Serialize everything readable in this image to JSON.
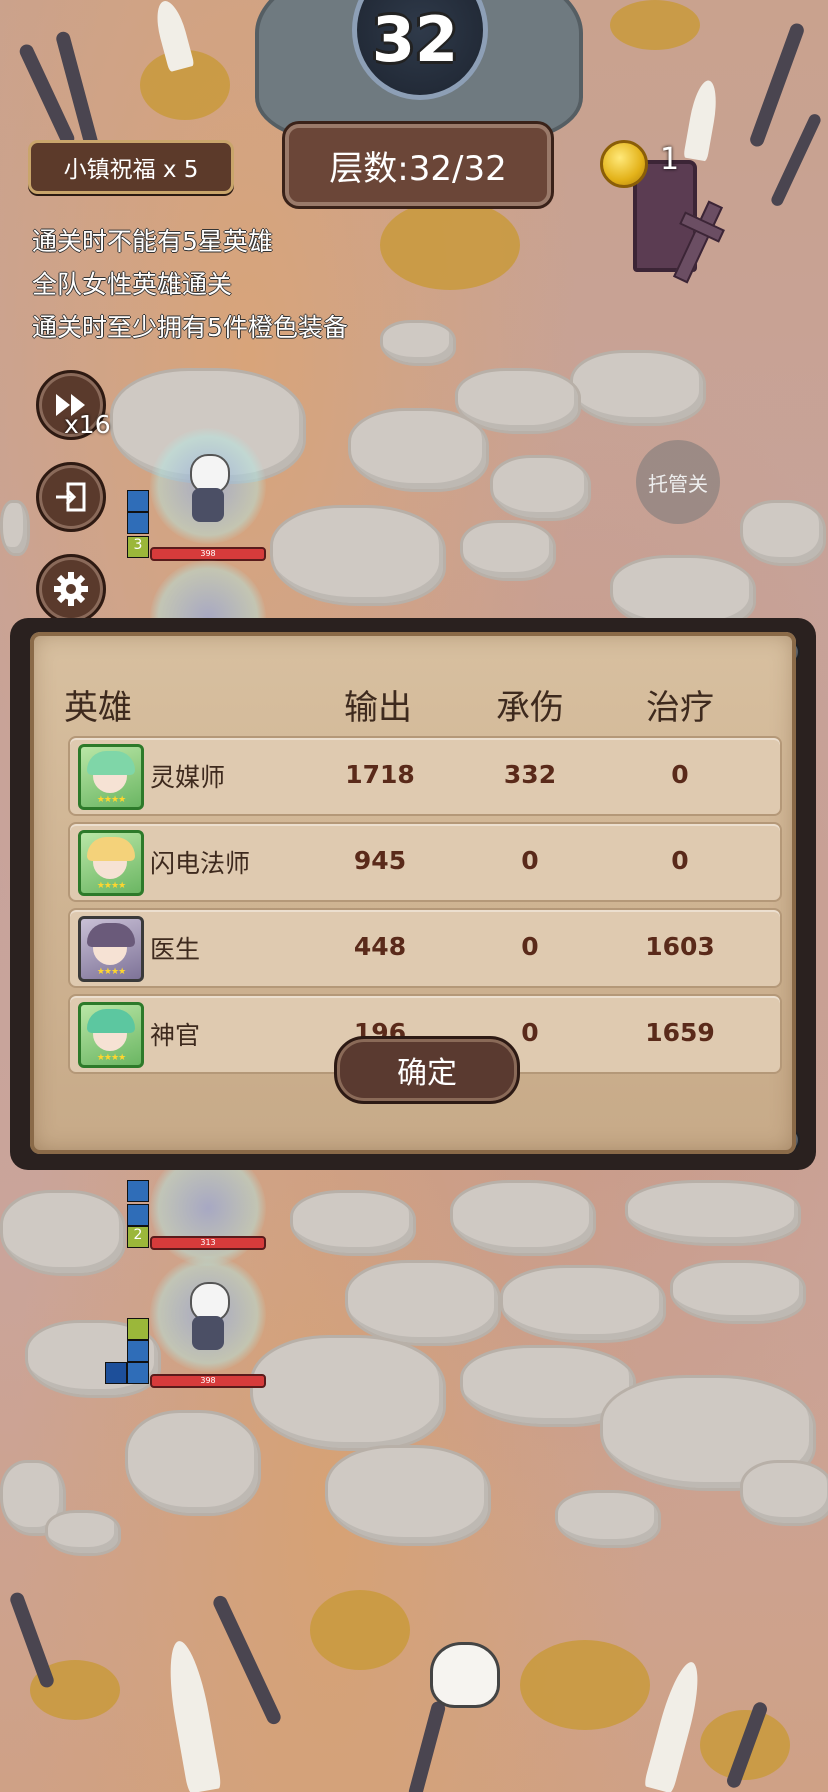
{
  "hud": {
    "timer": "32",
    "blessing": "小镇祝福 x 5",
    "floor": "层数:32/32",
    "coins": "1",
    "conditions": [
      "通关时不能有5星英雄",
      "全队女性英雄通关",
      "通关时至少拥有5件橙色装备"
    ],
    "speed": "x16",
    "auto_label": "托管关"
  },
  "units": {
    "hp": [
      "398",
      "313",
      "398"
    ],
    "levels": [
      "3",
      "2"
    ]
  },
  "results": {
    "headers": {
      "hero": "英雄",
      "output": "输出",
      "damage_taken": "承伤",
      "healing": "治疗"
    },
    "rows": [
      {
        "name": "灵媒师",
        "output": "1718",
        "taken": "332",
        "heal": "0",
        "hair": "#7fd6a8"
      },
      {
        "name": "闪电法师",
        "output": "945",
        "taken": "0",
        "heal": "0",
        "hair": "#f4d27a"
      },
      {
        "name": "医生",
        "output": "448",
        "taken": "0",
        "heal": "1603",
        "hair": "#6a5a7a"
      },
      {
        "name": "神官",
        "output": "196",
        "taken": "0",
        "heal": "1659",
        "hair": "#5cc7a0"
      }
    ],
    "stars": "★★★★",
    "confirm": "确定"
  },
  "colors": {
    "panel_text": "#3e2a1e",
    "value_text": "#5a2a1a",
    "hp_bar": "#d63b3b"
  }
}
